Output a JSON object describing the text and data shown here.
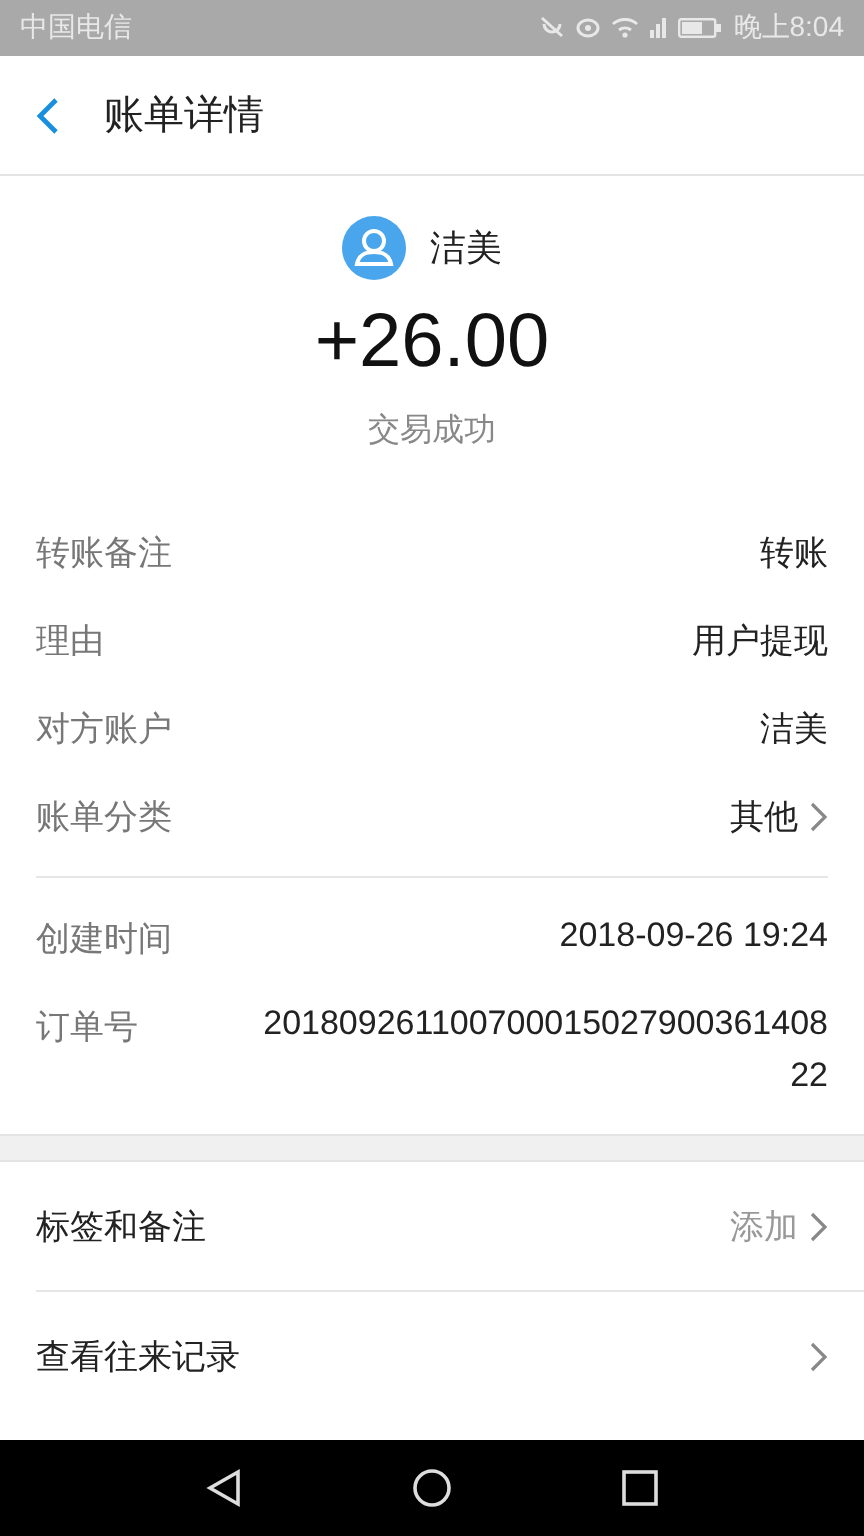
{
  "status_bar": {
    "carrier": "中国电信",
    "time": "晚上8:04"
  },
  "header": {
    "title": "账单详情"
  },
  "summary": {
    "name": "洁美",
    "amount": "+26.00",
    "status": "交易成功"
  },
  "details": [
    {
      "label": "转账备注",
      "value": "转账",
      "chevron": false
    },
    {
      "label": "理由",
      "value": "用户提现",
      "chevron": false
    },
    {
      "label": "对方账户",
      "value": "洁美",
      "chevron": false
    },
    {
      "label": "账单分类",
      "value": "其他",
      "chevron": true
    }
  ],
  "record": [
    {
      "label": "创建时间",
      "value": "2018-09-26 19:24"
    },
    {
      "label": "订单号",
      "value": "201809261100700015027900361408 22"
    }
  ],
  "actions": [
    {
      "label": "标签和备注",
      "value": "添加",
      "chevron": true
    },
    {
      "label": "查看往来记录",
      "chevron": true
    }
  ]
}
